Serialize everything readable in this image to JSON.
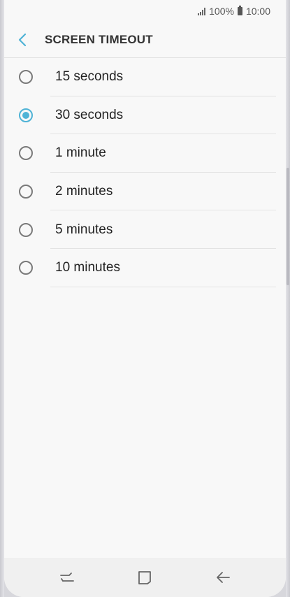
{
  "status_bar": {
    "battery": "100%",
    "time": "10:00"
  },
  "header": {
    "title": "SCREEN TIMEOUT"
  },
  "options": [
    {
      "label": "15 seconds",
      "selected": false
    },
    {
      "label": "30 seconds",
      "selected": true
    },
    {
      "label": "1 minute",
      "selected": false
    },
    {
      "label": "2 minutes",
      "selected": false
    },
    {
      "label": "5 minutes",
      "selected": false
    },
    {
      "label": "10 minutes",
      "selected": false
    }
  ],
  "colors": {
    "accent": "#4fb3d6",
    "background": "#f8f8f8"
  },
  "icons": {
    "back": "chevron-left-icon",
    "recents": "recents-icon",
    "home": "home-icon",
    "nav_back": "back-arrow-icon"
  }
}
